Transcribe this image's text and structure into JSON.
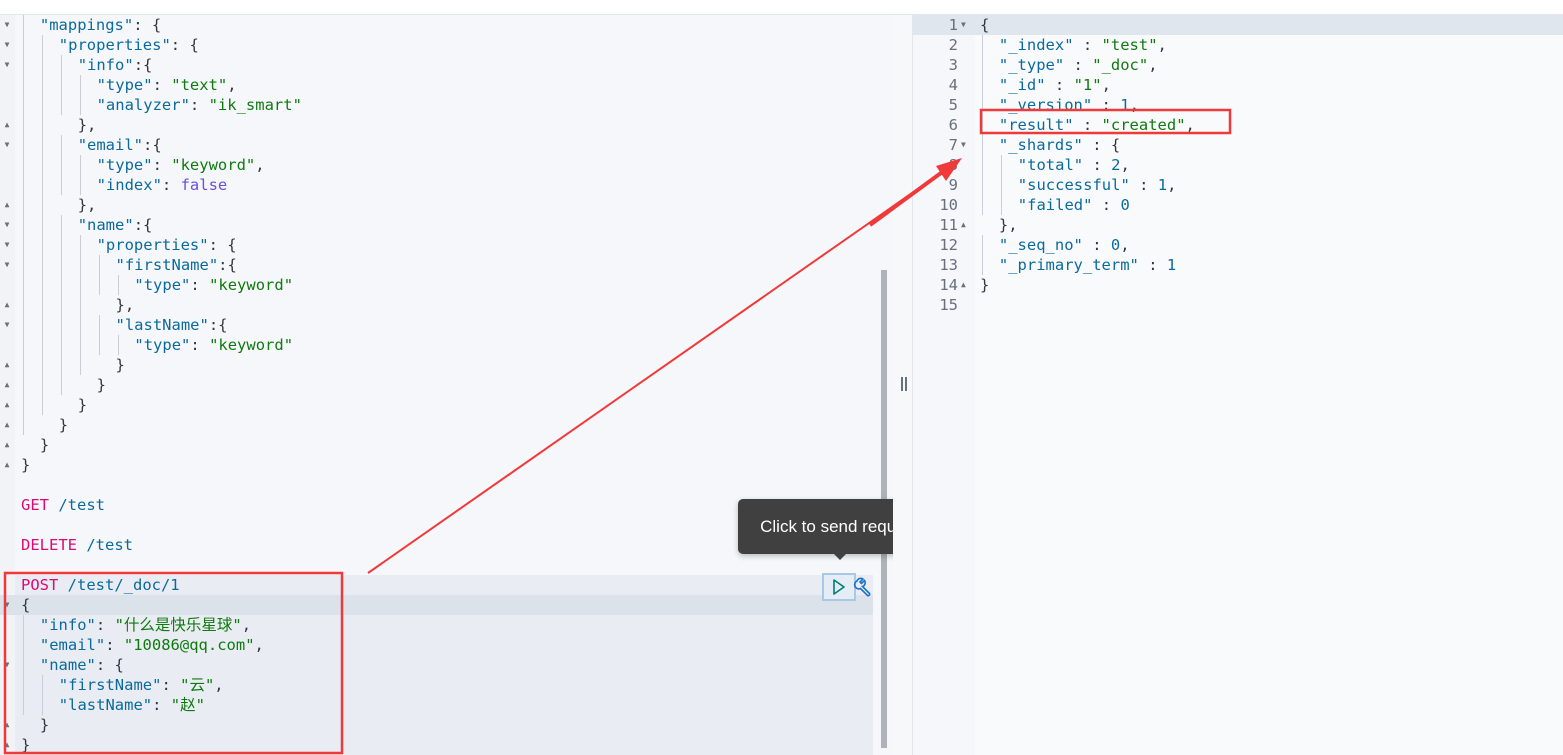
{
  "colors": {
    "annotation_red": "#f03a3a",
    "key": "#0b6a9d",
    "string": "#0f7b0f",
    "boolean": "#6b4fe0",
    "method": "#dd0a73"
  },
  "editor": {
    "lines": [
      {
        "indent": 1,
        "fold": "down",
        "t": [
          [
            "k",
            "\"mappings\""
          ],
          [
            "p",
            ": {"
          ]
        ]
      },
      {
        "indent": 2,
        "fold": "down",
        "t": [
          [
            "k",
            "\"properties\""
          ],
          [
            "p",
            ": {"
          ]
        ]
      },
      {
        "indent": 3,
        "fold": "down",
        "t": [
          [
            "k",
            "\"info\""
          ],
          [
            "p",
            ":{"
          ]
        ]
      },
      {
        "indent": 4,
        "t": [
          [
            "k",
            "\"type\""
          ],
          [
            "p",
            ": "
          ],
          [
            "s",
            "\"text\""
          ],
          [
            "p",
            ","
          ]
        ]
      },
      {
        "indent": 4,
        "t": [
          [
            "k",
            "\"analyzer\""
          ],
          [
            "p",
            ": "
          ],
          [
            "s",
            "\"ik_smart\""
          ]
        ]
      },
      {
        "indent": 3,
        "fold": "up",
        "t": [
          [
            "p",
            "},"
          ]
        ]
      },
      {
        "indent": 3,
        "fold": "down",
        "t": [
          [
            "k",
            "\"email\""
          ],
          [
            "p",
            ":{"
          ]
        ]
      },
      {
        "indent": 4,
        "t": [
          [
            "k",
            "\"type\""
          ],
          [
            "p",
            ": "
          ],
          [
            "s",
            "\"keyword\""
          ],
          [
            "p",
            ","
          ]
        ]
      },
      {
        "indent": 4,
        "t": [
          [
            "k",
            "\"index\""
          ],
          [
            "p",
            ": "
          ],
          [
            "b",
            "false"
          ]
        ]
      },
      {
        "indent": 3,
        "fold": "up",
        "t": [
          [
            "p",
            "},"
          ]
        ]
      },
      {
        "indent": 3,
        "fold": "down",
        "t": [
          [
            "k",
            "\"name\""
          ],
          [
            "p",
            ":{"
          ]
        ]
      },
      {
        "indent": 4,
        "fold": "down",
        "t": [
          [
            "k",
            "\"properties\""
          ],
          [
            "p",
            ": {"
          ]
        ]
      },
      {
        "indent": 5,
        "fold": "down",
        "t": [
          [
            "k",
            "\"firstName\""
          ],
          [
            "p",
            ":{"
          ]
        ]
      },
      {
        "indent": 6,
        "t": [
          [
            "k",
            "\"type\""
          ],
          [
            "p",
            ": "
          ],
          [
            "s",
            "\"keyword\""
          ]
        ]
      },
      {
        "indent": 5,
        "fold": "up",
        "t": [
          [
            "p",
            "},"
          ]
        ]
      },
      {
        "indent": 5,
        "fold": "down",
        "t": [
          [
            "k",
            "\"lastName\""
          ],
          [
            "p",
            ":{"
          ]
        ]
      },
      {
        "indent": 6,
        "t": [
          [
            "k",
            "\"type\""
          ],
          [
            "p",
            ": "
          ],
          [
            "s",
            "\"keyword\""
          ]
        ]
      },
      {
        "indent": 5,
        "fold": "up",
        "t": [
          [
            "p",
            "}"
          ]
        ]
      },
      {
        "indent": 4,
        "fold": "up",
        "t": [
          [
            "p",
            "}"
          ]
        ]
      },
      {
        "indent": 3,
        "fold": "up",
        "t": [
          [
            "p",
            "}"
          ]
        ]
      },
      {
        "indent": 2,
        "fold": "up",
        "t": [
          [
            "p",
            "}"
          ]
        ]
      },
      {
        "indent": 1,
        "fold": "up",
        "t": [
          [
            "p",
            "}"
          ]
        ]
      },
      {
        "indent": 0,
        "fold": "up",
        "t": [
          [
            "p",
            "}"
          ]
        ]
      },
      {
        "indent": 0,
        "t": []
      },
      {
        "indent": 0,
        "t": [
          [
            "m",
            "GET"
          ],
          [
            "u",
            " /test"
          ]
        ]
      },
      {
        "indent": 0,
        "t": []
      },
      {
        "indent": 0,
        "t": [
          [
            "m",
            "DELETE"
          ],
          [
            "u",
            " /test"
          ]
        ]
      },
      {
        "indent": 0,
        "t": []
      },
      {
        "indent": 0,
        "t": [
          [
            "m",
            "POST"
          ],
          [
            "u",
            " /test/_doc/1"
          ]
        ]
      },
      {
        "indent": 0,
        "fold": "down",
        "t": [
          [
            "p",
            "{"
          ]
        ]
      },
      {
        "indent": 1,
        "t": [
          [
            "k",
            "\"info\""
          ],
          [
            "p",
            ": "
          ],
          [
            "s",
            "\"什么是快乐星球\""
          ],
          [
            "p",
            ","
          ]
        ]
      },
      {
        "indent": 1,
        "t": [
          [
            "k",
            "\"email\""
          ],
          [
            "p",
            ": "
          ],
          [
            "s",
            "\"10086@qq.com\""
          ],
          [
            "p",
            ","
          ]
        ]
      },
      {
        "indent": 1,
        "fold": "down",
        "t": [
          [
            "k",
            "\"name\""
          ],
          [
            "p",
            ": {"
          ]
        ]
      },
      {
        "indent": 2,
        "t": [
          [
            "k",
            "\"firstName\""
          ],
          [
            "p",
            ": "
          ],
          [
            "s",
            "\"云\""
          ],
          [
            "p",
            ","
          ]
        ]
      },
      {
        "indent": 2,
        "t": [
          [
            "k",
            "\"lastName\""
          ],
          [
            "p",
            ": "
          ],
          [
            "s",
            "\"赵\""
          ]
        ]
      },
      {
        "indent": 1,
        "fold": "up",
        "t": [
          [
            "p",
            "}"
          ]
        ]
      },
      {
        "indent": 0,
        "fold": "up",
        "t": [
          [
            "p",
            "}"
          ]
        ]
      }
    ],
    "tooltip": "Click to send request",
    "play_icon": "play-icon",
    "wrench_icon": "wrench-icon"
  },
  "response": {
    "lines": [
      {
        "n": "1",
        "fold": "down",
        "indent": 0,
        "t": [
          [
            "p",
            "{"
          ]
        ]
      },
      {
        "n": "2",
        "indent": 1,
        "t": [
          [
            "k",
            "\"_index\""
          ],
          [
            "p",
            " : "
          ],
          [
            "s",
            "\"test\""
          ],
          [
            "p",
            ","
          ]
        ]
      },
      {
        "n": "3",
        "indent": 1,
        "t": [
          [
            "k",
            "\"_type\""
          ],
          [
            "p",
            " : "
          ],
          [
            "s",
            "\"_doc\""
          ],
          [
            "p",
            ","
          ]
        ]
      },
      {
        "n": "4",
        "indent": 1,
        "t": [
          [
            "k",
            "\"_id\""
          ],
          [
            "p",
            " : "
          ],
          [
            "s",
            "\"1\""
          ],
          [
            "p",
            ","
          ]
        ]
      },
      {
        "n": "5",
        "indent": 1,
        "t": [
          [
            "k",
            "\"_version\""
          ],
          [
            "p",
            " : "
          ],
          [
            "n",
            "1"
          ],
          [
            "p",
            ","
          ]
        ]
      },
      {
        "n": "6",
        "indent": 1,
        "t": [
          [
            "k",
            "\"result\""
          ],
          [
            "p",
            " : "
          ],
          [
            "s",
            "\"created\""
          ],
          [
            "p",
            ","
          ]
        ]
      },
      {
        "n": "7",
        "fold": "down",
        "indent": 1,
        "t": [
          [
            "k",
            "\"_shards\""
          ],
          [
            "p",
            " : {"
          ]
        ]
      },
      {
        "n": "8",
        "indent": 2,
        "t": [
          [
            "k",
            "\"total\""
          ],
          [
            "p",
            " : "
          ],
          [
            "n",
            "2"
          ],
          [
            "p",
            ","
          ]
        ]
      },
      {
        "n": "9",
        "indent": 2,
        "t": [
          [
            "k",
            "\"successful\""
          ],
          [
            "p",
            " : "
          ],
          [
            "n",
            "1"
          ],
          [
            "p",
            ","
          ]
        ]
      },
      {
        "n": "10",
        "indent": 2,
        "t": [
          [
            "k",
            "\"failed\""
          ],
          [
            "p",
            " : "
          ],
          [
            "n",
            "0"
          ]
        ]
      },
      {
        "n": "11",
        "fold": "up",
        "indent": 1,
        "t": [
          [
            "p",
            "},"
          ]
        ]
      },
      {
        "n": "12",
        "indent": 1,
        "t": [
          [
            "k",
            "\"_seq_no\""
          ],
          [
            "p",
            " : "
          ],
          [
            "n",
            "0"
          ],
          [
            "p",
            ","
          ]
        ]
      },
      {
        "n": "13",
        "indent": 1,
        "t": [
          [
            "k",
            "\"_primary_term\""
          ],
          [
            "p",
            " : "
          ],
          [
            "n",
            "1"
          ]
        ]
      },
      {
        "n": "14",
        "fold": "up",
        "indent": 0,
        "t": [
          [
            "p",
            "}"
          ]
        ]
      },
      {
        "n": "15",
        "indent": 0,
        "t": []
      }
    ]
  }
}
